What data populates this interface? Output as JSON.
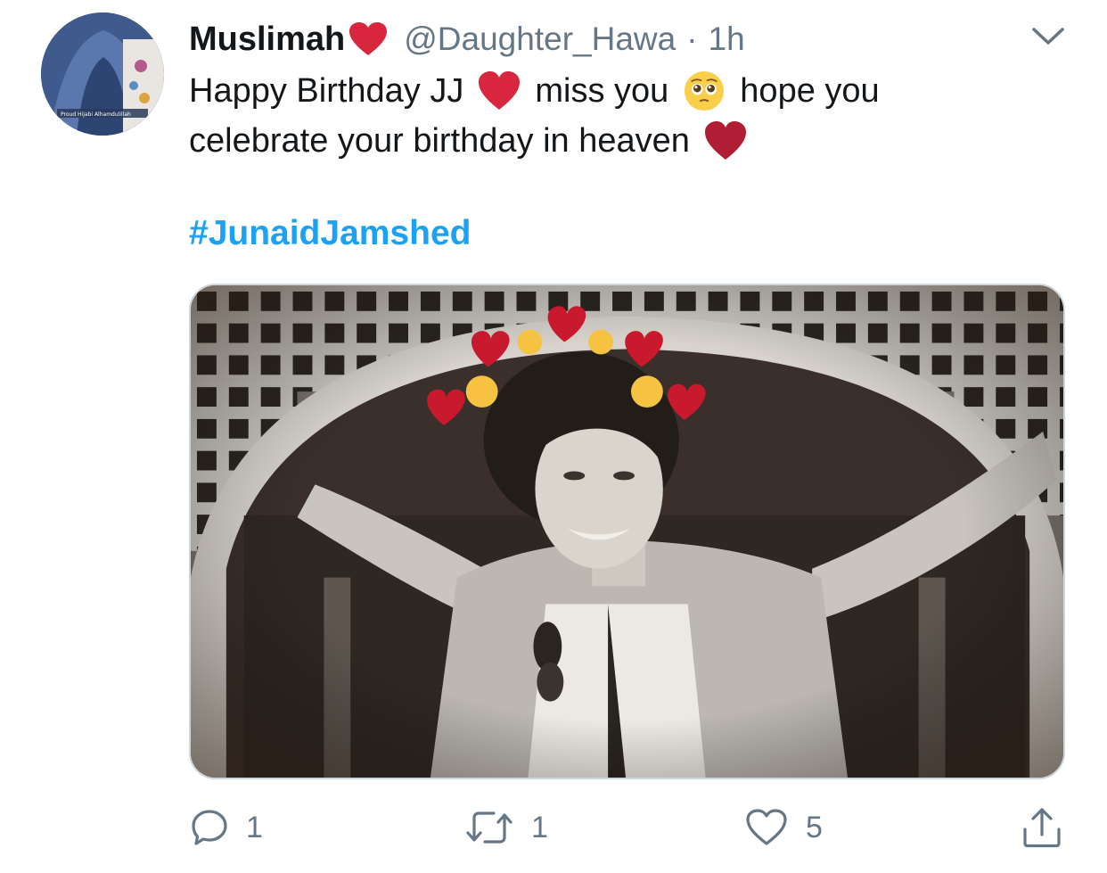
{
  "author": {
    "display_name": "Muslimah",
    "handle": "@Daughter_Hawa",
    "separator": "·",
    "timestamp": "1h",
    "avatar_caption": "Proud Hijabi Alhamdulillah"
  },
  "tweet": {
    "line1_part1": "Happy Birthday JJ",
    "line1_part2": "miss you",
    "line1_part3": "hope you",
    "line2": "celebrate your birthday in heaven",
    "hashtag": "#JunaidJamshed"
  },
  "icons": {
    "more": "chevron-down-icon",
    "reply": "comment-icon",
    "retweet": "retweet-icon",
    "like": "heart-icon",
    "share": "share-icon",
    "emoji_heart": "red-heart-emoji",
    "emoji_pleading": "pleading-face-emoji"
  },
  "actions": {
    "reply_count": "1",
    "retweet_count": "1",
    "like_count": "5"
  },
  "colors": {
    "text": "#14171a",
    "secondary": "#657786",
    "link": "#1da1f2",
    "heart_red": "#d7263d"
  }
}
